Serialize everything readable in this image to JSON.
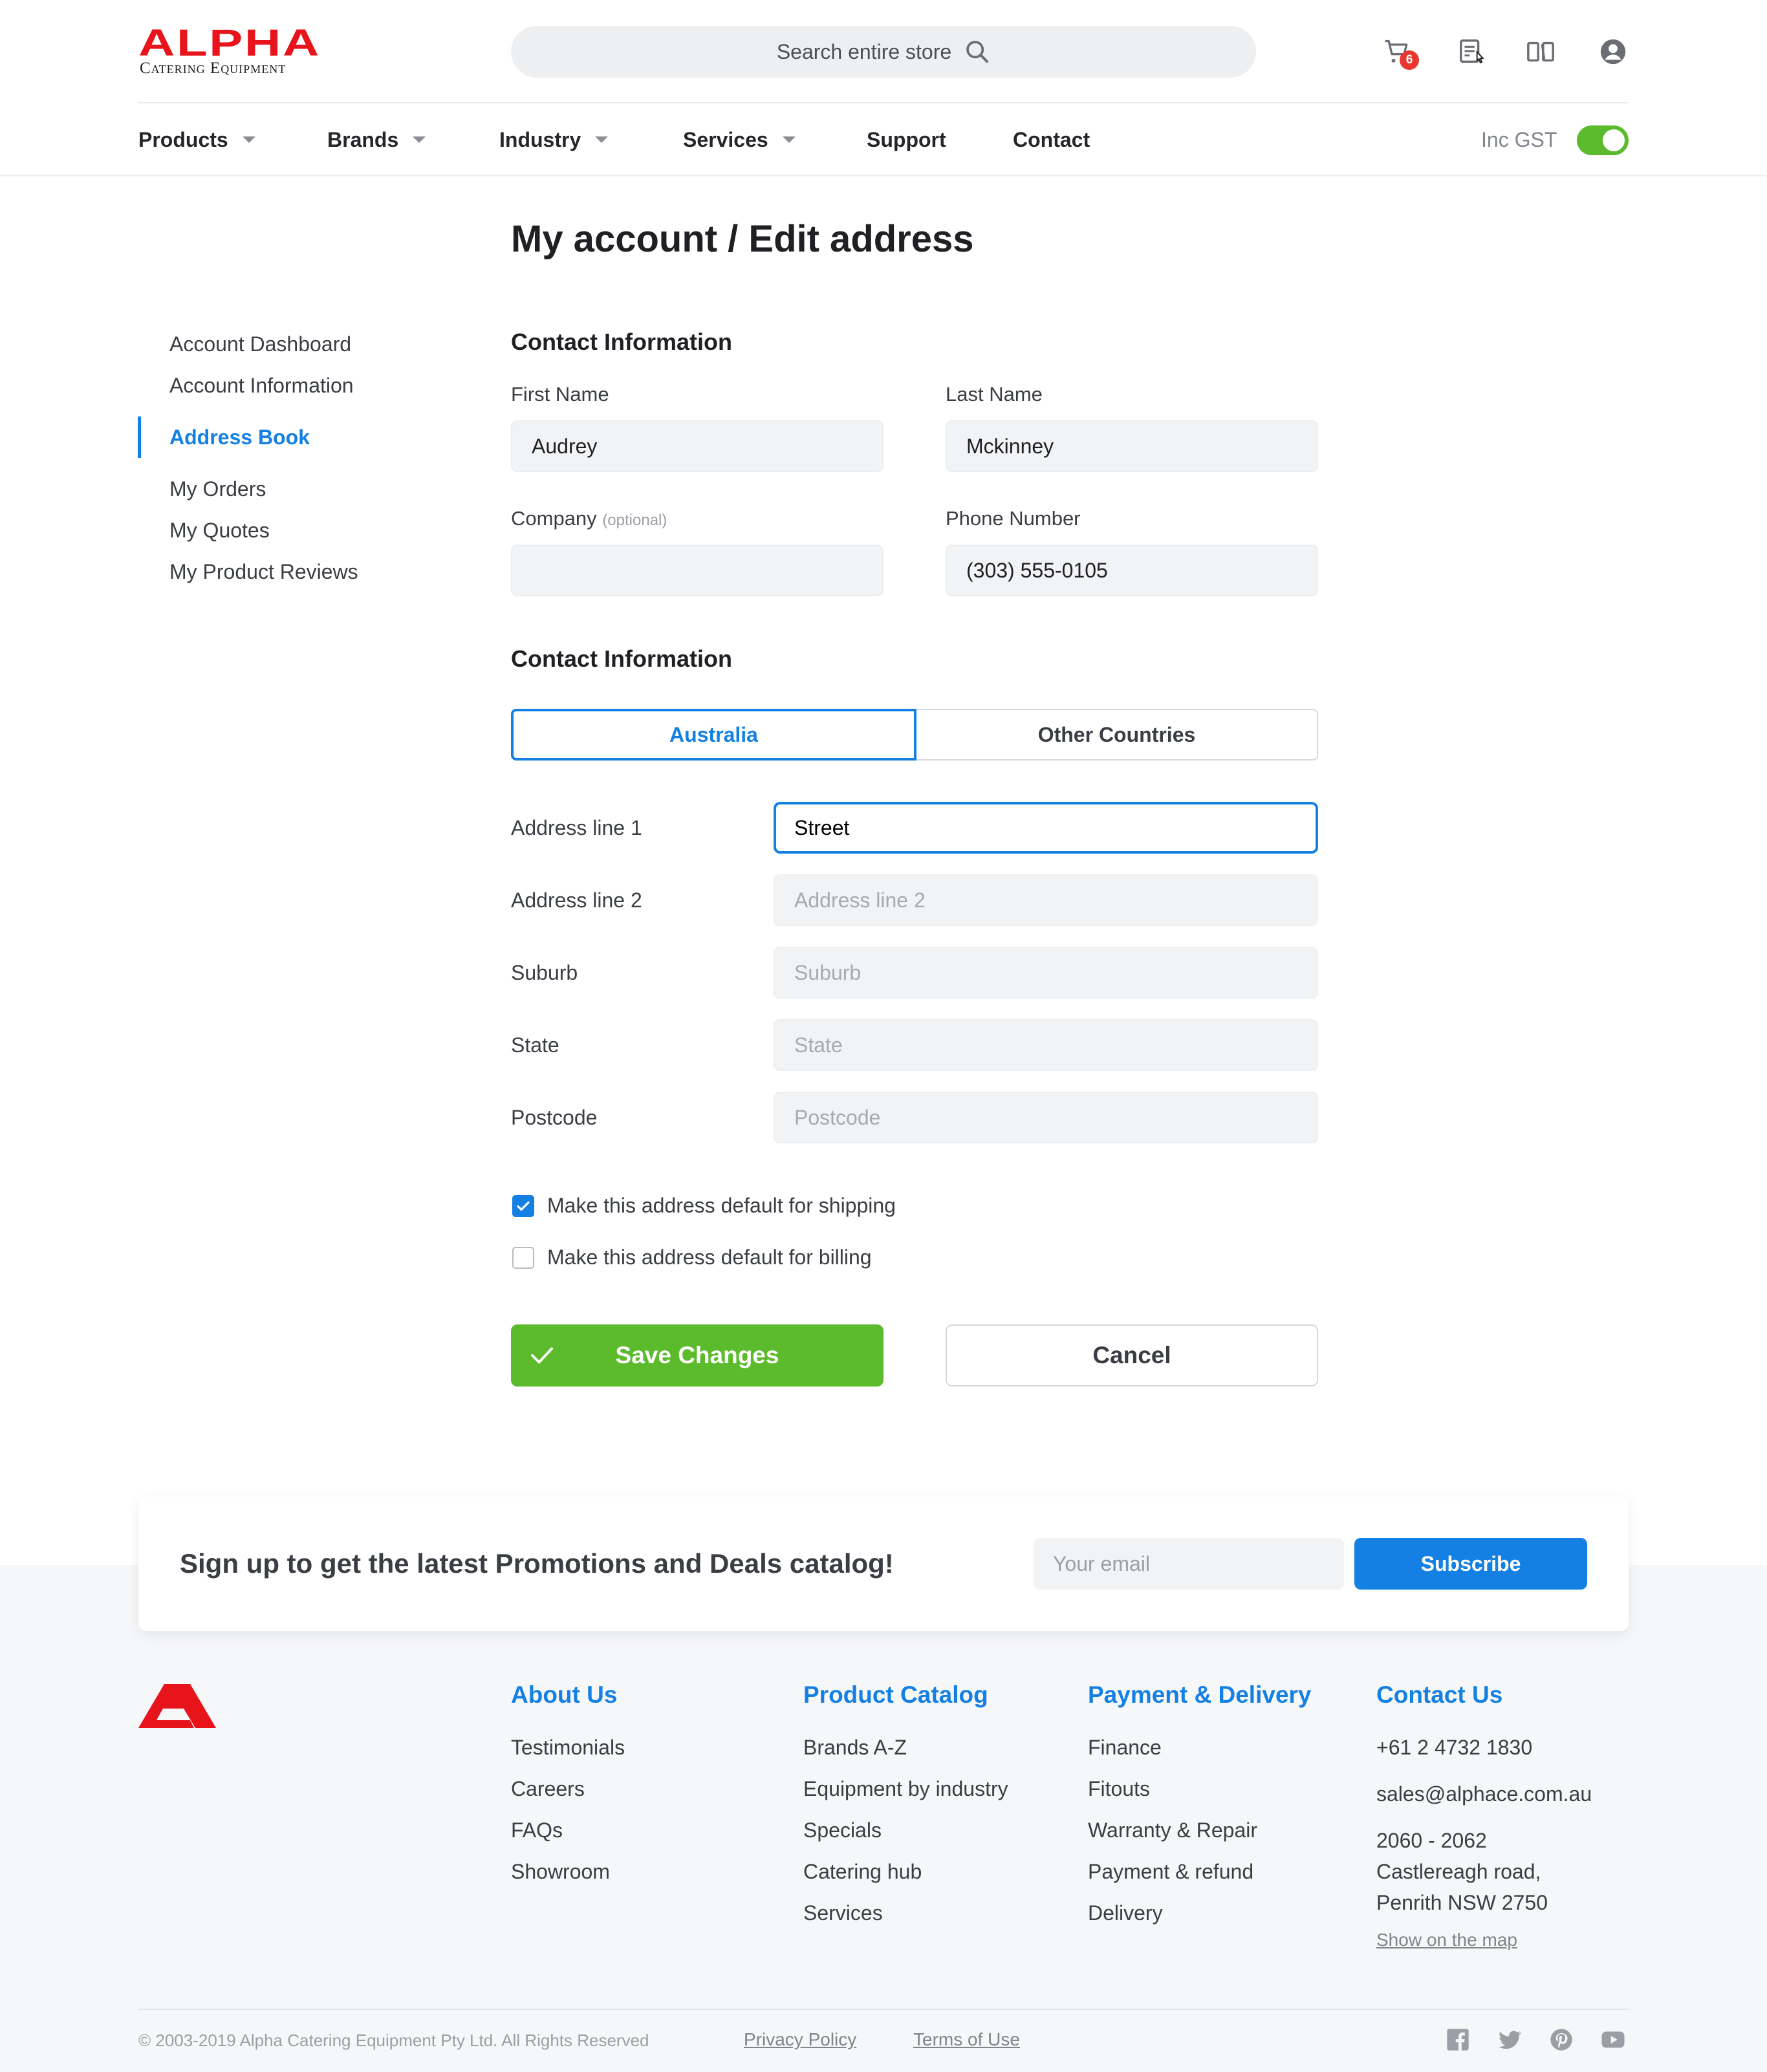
{
  "brand": {
    "logo_text": "ALPHA",
    "logo_sub": "Catering Equipment",
    "color": "#e8141c"
  },
  "header": {
    "search_placeholder": "Search entire store",
    "cart_count": "6",
    "icons": [
      "cart-icon",
      "quote-icon",
      "compare-icon",
      "user-icon"
    ]
  },
  "nav": {
    "items": [
      {
        "label": "Products",
        "dropdown": true
      },
      {
        "label": "Brands",
        "dropdown": true
      },
      {
        "label": "Industry",
        "dropdown": true
      },
      {
        "label": "Services",
        "dropdown": true
      },
      {
        "label": "Support",
        "dropdown": false
      },
      {
        "label": "Contact",
        "dropdown": false
      }
    ],
    "gst_label": "Inc GST",
    "gst_on": true
  },
  "page": {
    "title": "My account / Edit address"
  },
  "sidebar": {
    "items": [
      {
        "label": "Account Dashboard",
        "active": false
      },
      {
        "label": "Account Information",
        "active": false
      },
      {
        "label": "Address Book",
        "active": true
      },
      {
        "label": "My Orders",
        "active": false
      },
      {
        "label": "My Quotes",
        "active": false
      },
      {
        "label": "My Product Reviews",
        "active": false
      }
    ]
  },
  "contact": {
    "heading": "Contact Information",
    "first_name_label": "First Name",
    "first_name": "Audrey",
    "last_name_label": "Last Name",
    "last_name": "Mckinney",
    "company_label": "Company",
    "company_optional": "(optional)",
    "company": "",
    "phone_label": "Phone Number",
    "phone": "(303) 555-0105"
  },
  "address": {
    "heading": "Contact Information",
    "tabs": [
      "Australia",
      "Other Countries"
    ],
    "active_tab": "Australia",
    "fields": [
      {
        "label": "Address line 1",
        "value": "Street",
        "placeholder": ""
      },
      {
        "label": "Address line 2",
        "value": "",
        "placeholder": "Address line 2"
      },
      {
        "label": "Suburb",
        "value": "",
        "placeholder": "Suburb"
      },
      {
        "label": "State",
        "value": "",
        "placeholder": "State"
      },
      {
        "label": "Postcode",
        "value": "",
        "placeholder": "Postcode"
      }
    ],
    "default_shipping_label": "Make this address default for shipping",
    "default_shipping": true,
    "default_billing_label": "Make this address default for billing",
    "default_billing": false
  },
  "actions": {
    "save_label": "Save Changes",
    "cancel_label": "Cancel"
  },
  "signup": {
    "text": "Sign up to get the latest Promotions and Deals catalog!",
    "email_placeholder": "Your email",
    "button_label": "Subscribe"
  },
  "footer": {
    "columns": [
      {
        "heading": "About Us",
        "items": [
          "Testimonials",
          "Careers",
          "FAQs",
          "Showroom"
        ]
      },
      {
        "heading": "Product Catalog",
        "items": [
          "Brands A-Z",
          "Equipment by industry",
          "Specials",
          "Catering hub",
          "Services"
        ]
      },
      {
        "heading": "Payment & Delivery",
        "items": [
          "Finance",
          "Fitouts",
          "Warranty & Repair",
          "Payment & refund",
          "Delivery"
        ]
      }
    ],
    "contact": {
      "heading": "Contact Us",
      "phone": "+61 2 4732 1830",
      "email": "sales@alphace.com.au",
      "address_line1": "2060 - 2062",
      "address_line2": "Castlereagh road,",
      "address_line3": "Penrith NSW 2750",
      "map_link": "Show on the map"
    },
    "copyright": "© 2003-2019 Alpha Catering Equipment Pty Ltd. All Rights Reserved",
    "privacy": "Privacy Policy",
    "terms": "Terms of Use",
    "social": [
      "facebook-icon",
      "twitter-icon",
      "pinterest-icon",
      "youtube-icon"
    ]
  },
  "colors": {
    "accent": "#1480e3",
    "success": "#5cbb2c",
    "badge": "#e8372f"
  }
}
